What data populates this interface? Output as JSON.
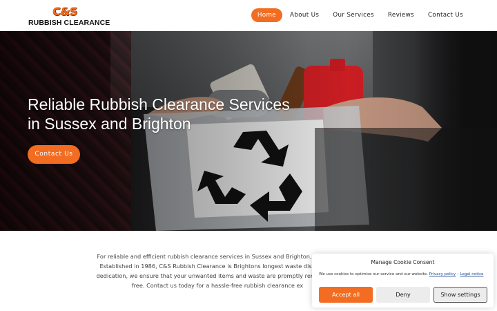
{
  "brand": {
    "logo_top": "C&S",
    "logo_bottom": "RUBBISH CLEARANCE",
    "accent_color": "#f26d21"
  },
  "nav": {
    "items": [
      {
        "label": "Home",
        "active": true
      },
      {
        "label": "About Us",
        "active": false
      },
      {
        "label": "Our Services",
        "active": false
      },
      {
        "label": "Reviews",
        "active": false
      },
      {
        "label": "Contact Us",
        "active": false
      }
    ]
  },
  "hero": {
    "title_line1": "Reliable Rubbish Clearance Services",
    "title_line2": "in Sussex and Brighton",
    "button_label": "Contact Us",
    "image_icon": "recycle-icon"
  },
  "intro": {
    "lines": [
      "For reliable and efficient rubbish clearance services in Sussex and Brighton, trust the",
      "Established in 1986, C&S Rubbish Clearance is Brightons longest waste disposal co",
      "dedication, we ensure that your unwanted items and waste are promptly removed, le",
      "free. Contact us today for a hassle-free rubbish clearance ex"
    ]
  },
  "cookie": {
    "title": "Manage Cookie Consent",
    "text": "We use cookies to optimise our service and our website.",
    "privacy_link": "Privacy policy",
    "separator": "–",
    "legal_link": "Legal notice",
    "accept_label": "Accept all",
    "deny_label": "Deny",
    "settings_label": "Show settings"
  }
}
